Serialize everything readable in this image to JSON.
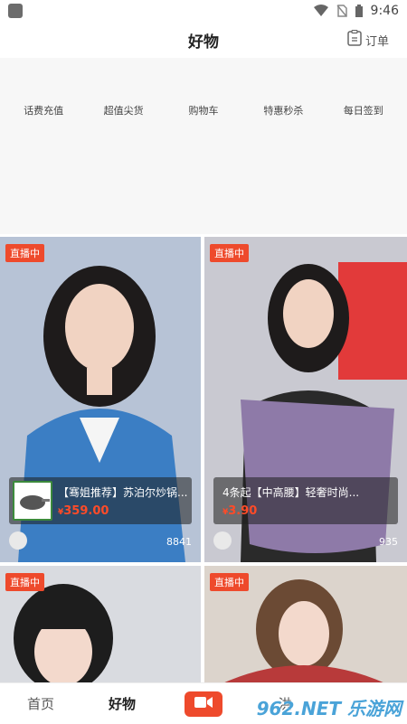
{
  "status_bar": {
    "time": "9:46"
  },
  "header": {
    "title": "好物",
    "order_label": "订单"
  },
  "categories": [
    "话费充值",
    "超值尖货",
    "购物车",
    "特惠秒杀",
    "每日签到"
  ],
  "live_cards": [
    {
      "badge": "直播中",
      "product_name": "【骞姐推荐】苏泊尔炒锅...",
      "price_symbol": "¥",
      "price": "359.00",
      "viewers": "8841",
      "bg": "#b7c3d6",
      "accent": "#3b7ec4"
    },
    {
      "badge": "直播中",
      "product_name": "4条起【中高腰】轻奢时尚...",
      "price_symbol": "¥",
      "price": "3.90",
      "viewers": "935",
      "bg": "#c9c9d1",
      "accent": "#8e7aa8"
    },
    {
      "badge": "直播中",
      "bg": "#d9dbe0",
      "accent": "#1d1d1d"
    },
    {
      "badge": "直播中",
      "bg": "#dcd4cc",
      "accent": "#b83a3a"
    }
  ],
  "bottom_nav": {
    "home": "首页",
    "goods": "好物",
    "discover": "洪",
    "watermark": "962.NET 乐游网"
  },
  "colors": {
    "accent": "#ee4a2c",
    "price": "#ff4b28"
  }
}
